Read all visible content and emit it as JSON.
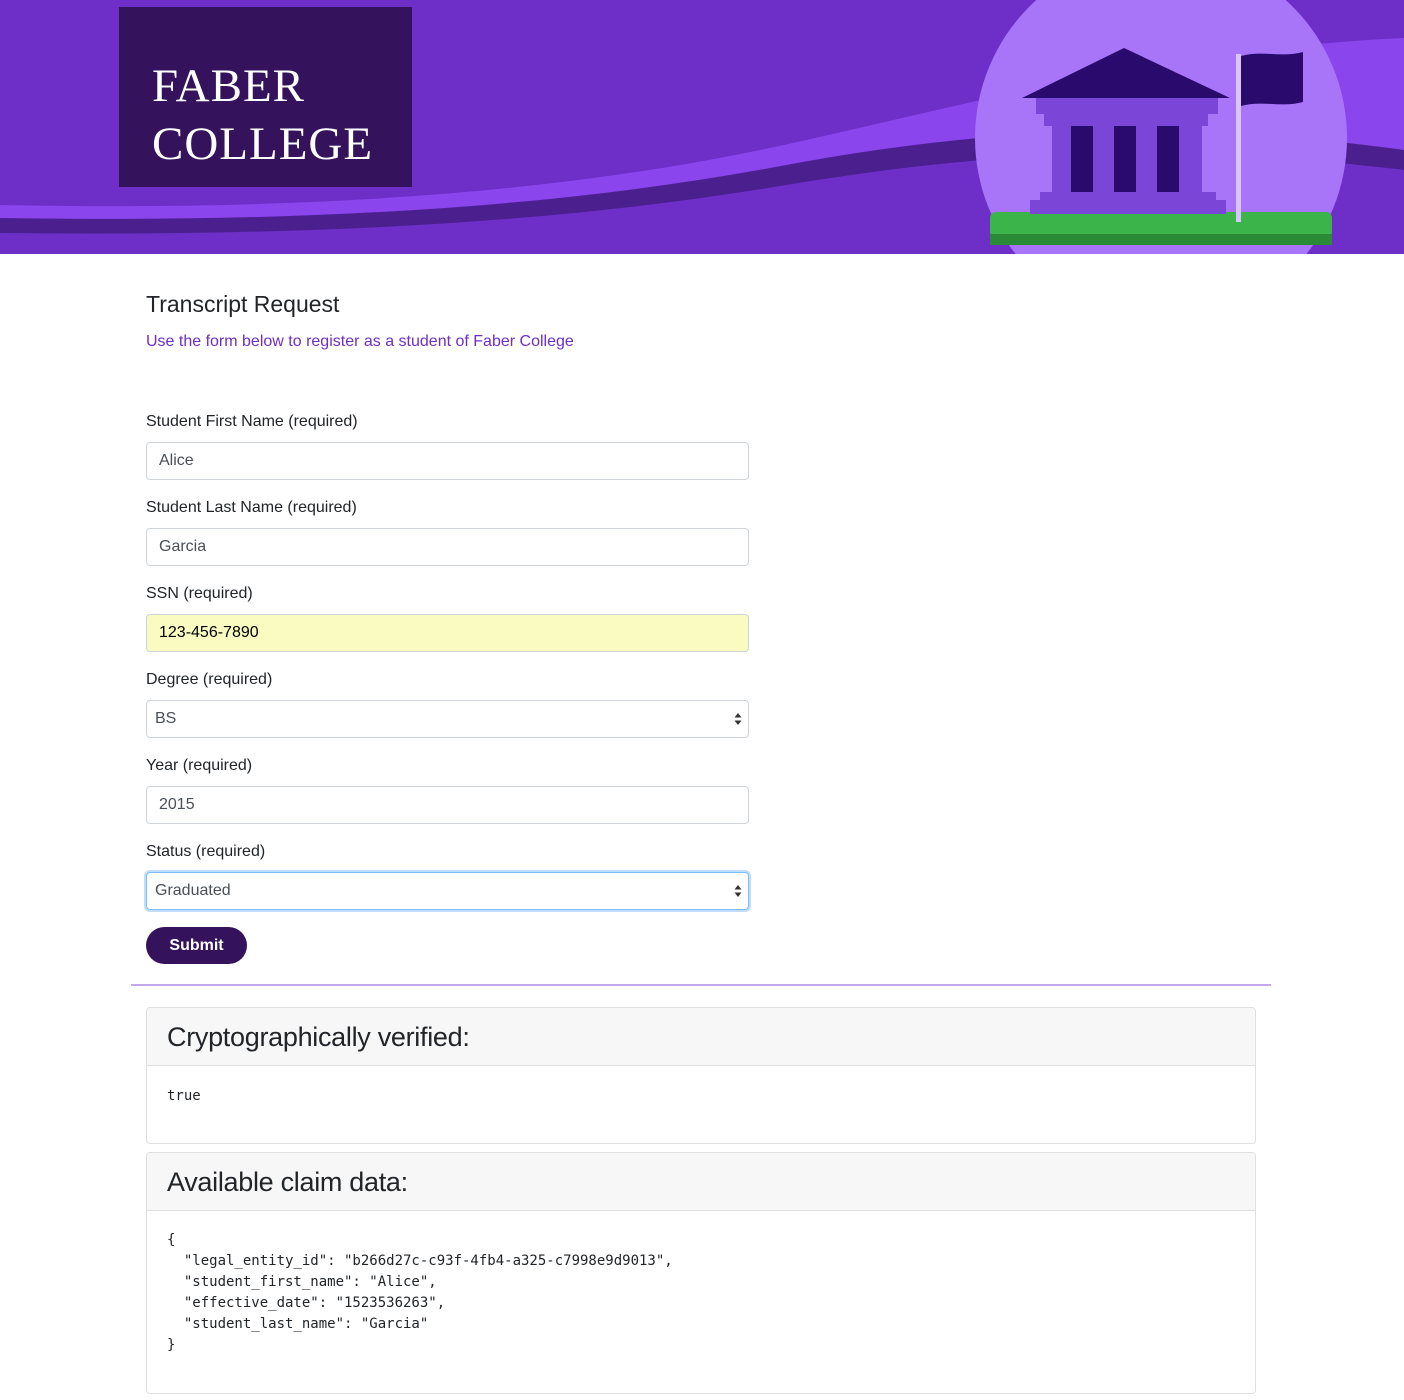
{
  "header": {
    "logo_line1": "FABER",
    "logo_line2": "COLLEGE",
    "brand_color": "#6d2fc7",
    "logo_bg_color": "#35135c"
  },
  "form": {
    "title": "Transcript Request",
    "subtitle": "Use the form below to register as a student of Faber College",
    "fields": {
      "first_name": {
        "label": "Student First Name (required)",
        "value": "Alice"
      },
      "last_name": {
        "label": "Student Last Name (required)",
        "value": "Garcia"
      },
      "ssn": {
        "label": "SSN (required)",
        "value": "123-456-7890"
      },
      "degree": {
        "label": "Degree (required)",
        "value": "BS"
      },
      "year": {
        "label": "Year (required)",
        "value": "2015"
      },
      "status": {
        "label": "Status (required)",
        "value": "Graduated"
      }
    },
    "submit_label": "Submit"
  },
  "verification": {
    "title": "Cryptographically verified:",
    "value": "true"
  },
  "claims": {
    "title": "Available claim data:",
    "lines": [
      "{",
      "  \"legal_entity_id\": \"b266d27c-c93f-4fb4-a325-c7998e9d9013\",",
      "  \"student_first_name\": \"Alice\",",
      "  \"effective_date\": \"1523536263\",",
      "  \"student_last_name\": \"Garcia\"",
      "}"
    ]
  }
}
